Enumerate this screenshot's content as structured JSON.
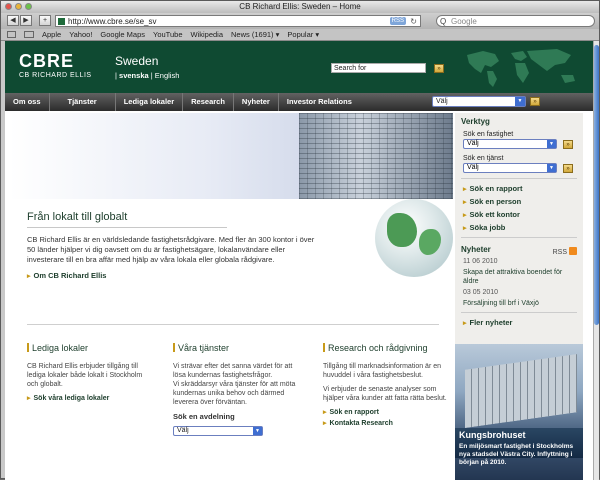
{
  "window": {
    "title": "CB Richard Ellis: Sweden – Home"
  },
  "toolbar": {
    "back_icon": "◀",
    "forward_icon": "▶",
    "add_icon": "+",
    "url": "http://www.cbre.se/se_sv",
    "rss_label": "RSS",
    "reload_icon": "↻",
    "search_placeholder": "Google",
    "search_g": "Q"
  },
  "bookmarks": [
    "Apple",
    "Yahoo!",
    "Google Maps",
    "YouTube",
    "Wikipedia",
    "News (1691) ▾",
    "Popular ▾"
  ],
  "header": {
    "logo": "CBRE",
    "logo_sub": "CB RICHARD ELLIS",
    "country": "Sweden",
    "lang_sv": "svenska",
    "lang_sep": " | ",
    "lang_en": "English",
    "search_label": "Search for",
    "go_label": "»"
  },
  "nav": {
    "items": [
      "Om oss",
      "Tjänster",
      "Lediga lokaler",
      "Research",
      "Nyheter",
      "Investor Relations"
    ],
    "select_value": "Välj",
    "go_label": "»"
  },
  "intro": {
    "title": "Från lokalt till globalt",
    "text": "CB Richard Ellis är en världsledande fastighetsrådgivare. Med fler än 300 kontor i över 50 länder hjälper vi dig oavsett om du är fastighetsägare, lokalanvändare eller investerare till en bra affär med hjälp av våra lokala eller globala rådgivare.",
    "link": "Om CB Richard Ellis"
  },
  "columns": {
    "lediga": {
      "title": "Lediga lokaler",
      "text": "CB Richard Ellis erbjuder tillgång till lediga lokaler både lokalt i Stockholm och globalt.",
      "link": "Sök våra lediga lokaler"
    },
    "tjanster": {
      "title": "Våra tjänster",
      "text1": "Vi strävar efter det sanna värdet för att lösa kundernas fastighetsfrågor.",
      "text2": "Vi skräddarsyr våra tjänster för att möta kundernas unika behov och därmed leverera över förväntan.",
      "sub": "Sök en avdelning",
      "select_value": "Välj"
    },
    "research": {
      "title": "Research och rådgivning",
      "text1": "Tillgång till marknadsinformation är en huvuddel i våra fastighetsbeslut.",
      "text2": "Vi erbjuder de senaste analyser som hjälper våra kunder att fatta rätta beslut.",
      "link1": "Sök en rapport",
      "link2": "Kontakta Research"
    }
  },
  "sidebar": {
    "title": "Verktyg",
    "label1": "Sök en fastighet",
    "select1": "Välj",
    "label2": "Sök en tjänst",
    "select2": "Välj",
    "go_label": "»",
    "links": [
      "Sök en rapport",
      "Sök en person",
      "Sök ett kontor",
      "Söka jobb"
    ],
    "news_title": "Nyheter",
    "rss_label": "RSS",
    "news": [
      {
        "date": "11 06 2010",
        "text": "Skapa det attraktiva boendet för äldre"
      },
      {
        "date": "03 05 2010",
        "text": "Försäljning till brf i Växjö"
      }
    ],
    "more_news": "Fler nyheter",
    "promo_title": "Kungsbrohuset",
    "promo_text": "En miljösmart fastighet i Stockholms nya stadsdel Västra City. Inflyttning i början på 2010."
  },
  "colors": {
    "brand_green": "#0f4a32",
    "accent_gold": "#c79a1a",
    "nav_dark": "#2b2b2b"
  }
}
